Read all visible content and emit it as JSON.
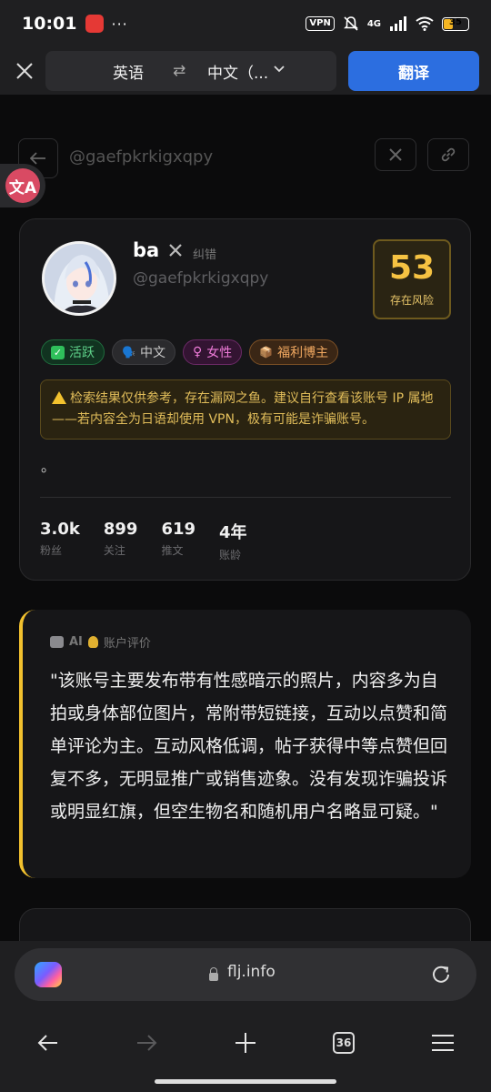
{
  "status_bar": {
    "time": "10:01",
    "dots": "···",
    "vpn": "VPN",
    "network": "4G",
    "battery": "35",
    "battery_level": 0.35
  },
  "translate_bar": {
    "source_lang": "英语",
    "swap_symbol": "⇄",
    "target_lang": "中文（...",
    "translate_button": "翻译"
  },
  "page": {
    "top_handle": "@gaefpkrkigxqpy",
    "profile": {
      "name": "ba",
      "fix_link": "纠错",
      "handle": "@gaefpkrkigxqpy",
      "risk_score": "53",
      "risk_label": "存在风险",
      "tags": [
        {
          "label": "活跃"
        },
        {
          "label": "中文",
          "icon": "🗣️"
        },
        {
          "label": "女性",
          "icon": "♀"
        },
        {
          "label": "福利博主",
          "icon": "📦"
        }
      ],
      "warning": "检索结果仅供参考，存在漏网之鱼。建议自行查看该账号 IP 属地——若内容全为日语却使用 VPN，极有可能是诈骗账号。",
      "bio": "。",
      "stats": [
        {
          "value": "3.0k",
          "label": "粉丝"
        },
        {
          "value": "899",
          "label": "关注"
        },
        {
          "value": "619",
          "label": "推文"
        },
        {
          "value": "4年",
          "label": "账龄"
        }
      ]
    },
    "ai_review": {
      "ai_label": "AI",
      "title": "账户评价",
      "text": "\"该账号主要发布带有性感暗示的照片，内容多为自拍或身体部位图片，常附带短链接，互动以点赞和简单评论为主。互动风格低调，帖子获得中等点赞但回复不多，无明显推广或销售迹象。没有发现诈骗投诉或明显红旗，但空生物名和随机用户名略显可疑。\""
    }
  },
  "browser": {
    "url": "flj.info",
    "tab_count": "36"
  }
}
